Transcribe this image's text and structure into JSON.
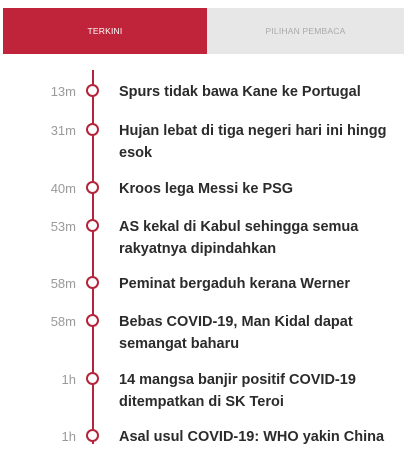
{
  "tabs": [
    {
      "label": "TERKINI",
      "active": true
    },
    {
      "label": "PILIHAN PEMBACA",
      "active": false
    }
  ],
  "colors": {
    "accent": "#c0243a",
    "timeline": "#b4243a",
    "tab_inactive_bg": "#e7e7e7"
  },
  "items": [
    {
      "time": "13m",
      "title_lines": [
        "Spurs tidak bawa Kane ke Portugal"
      ]
    },
    {
      "time": "31m",
      "title_lines": [
        "Hujan lebat di tiga negeri hari ini hingg",
        "esok"
      ]
    },
    {
      "time": "40m",
      "title_lines": [
        "Kroos lega Messi ke PSG"
      ]
    },
    {
      "time": "53m",
      "title_lines": [
        "AS kekal di Kabul sehingga semua",
        "rakyatnya dipindahkan"
      ]
    },
    {
      "time": "58m",
      "title_lines": [
        "Peminat bergaduh kerana Werner"
      ]
    },
    {
      "time": "58m",
      "title_lines": [
        "Bebas COVID-19, Man Kidal dapat",
        "semangat baharu"
      ]
    },
    {
      "time": "1h",
      "title_lines": [
        "14 mangsa banjir positif COVID-19",
        "ditempatkan di SK Teroi"
      ]
    },
    {
      "time": "1h",
      "title_lines": [
        "Asal usul COVID-19: WHO yakin China"
      ]
    }
  ]
}
